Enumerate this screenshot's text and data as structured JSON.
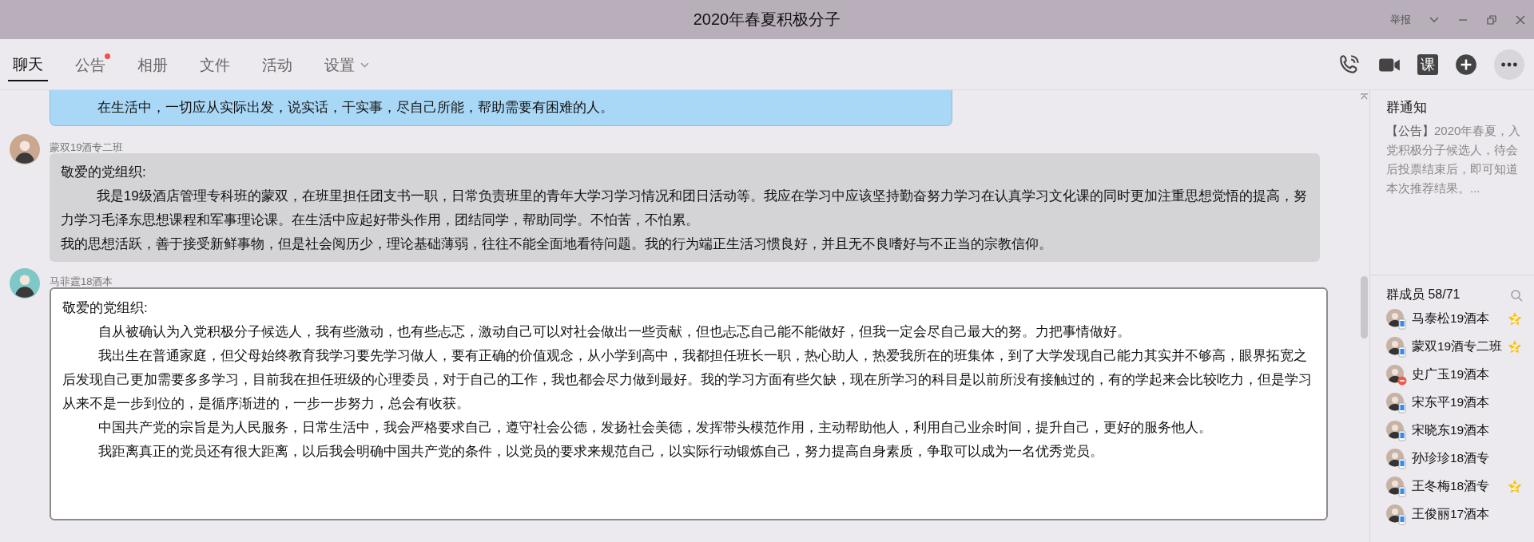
{
  "window": {
    "title": "2020年春夏积极分子",
    "report": "举报"
  },
  "tabs": [
    {
      "label": "聊天",
      "selected": true,
      "notification": false,
      "dropdown": false
    },
    {
      "label": "公告",
      "selected": false,
      "notification": true,
      "dropdown": false
    },
    {
      "label": "相册",
      "selected": false,
      "notification": false,
      "dropdown": false
    },
    {
      "label": "文件",
      "selected": false,
      "notification": false,
      "dropdown": false
    },
    {
      "label": "活动",
      "selected": false,
      "notification": false,
      "dropdown": false
    },
    {
      "label": "设置",
      "selected": false,
      "notification": false,
      "dropdown": true
    }
  ],
  "toolbar": [
    {
      "kind": "phone"
    },
    {
      "kind": "video"
    },
    {
      "kind": "lesson",
      "label": "课"
    },
    {
      "kind": "add"
    },
    {
      "kind": "more"
    }
  ],
  "messages": [
    {
      "kind": "announcement",
      "paragraphs": [
        {
          "text": "在生活中，一切应从实际出发，说实话，干实事，尽自己所能，帮助需要有困难的人。",
          "indented": true
        }
      ]
    },
    {
      "kind": "received",
      "sender": "蒙双19酒专二班",
      "paragraphs": [
        {
          "text": "敬爱的党组织:",
          "indented": false
        },
        {
          "text": "我是19级酒店管理专科班的蒙双，在班里担任团支书一职，日常负责班里的青年大学习学习情况和团日活动等。我应在学习中应该坚持勤奋努力学习在认真学习文化课的同时更加注重思想觉悟的提高，努力学习毛泽东思想课程和军事理论课。在生活中应起好带头作用，团结同学，帮助同学。不怕苦，不怕累。",
          "indented": true
        },
        {
          "text": "我的思想活跃，善于接受新鲜事物，但是社会阅历少，理论基础薄弱，往往不能全面地看待问题。我的行为端正生活习惯良好，并且无不良嗜好与不正当的宗教信仰。",
          "indented": false
        }
      ]
    },
    {
      "kind": "rich",
      "sender": "马菲霆18酒本",
      "paragraphs": [
        {
          "text": "敬爱的党组织:",
          "indented": false
        },
        {
          "text": "自从被确认为入党积极分子候选人，我有些激动，也有些忐忑，激动自己可以对社会做出一些贡献，但也忐忑自己能不能做好，但我一定会尽自己最大的努。力把事情做好。",
          "indented": true
        },
        {
          "text": "我出生在普通家庭，但父母始终教育我学习要先学习做人，要有正确的价值观念，从小学到高中，我都担任班长一职，热心助人，热爱我所在的班集体，到了大学发现自己能力其实并不够高，眼界拓宽之后发现自己更加需要多多学习，目前我在担任班级的心理委员，对于自己的工作，我也都会尽力做到最好。我的学习方面有些欠缺，现在所学习的科目是以前所没有接触过的，有的学起来会比较吃力，但是学习从来不是一步到位的，是循序渐进的，一步一步努力，总会有收获。",
          "indented": true
        },
        {
          "text": "中国共产党的宗旨是为人民服务，日常生活中，我会严格要求自己，遵守社会公德，发扬社会美德，发挥带头模范作用，主动帮助他人，利用自己业余时间，提升自己，更好的服务他人。",
          "indented": true
        },
        {
          "text": "我距离真正的党员还有很大距离，以后我会明确中国共产党的条件，以党员的要求来规范自己，以实际行动锻炼自己，努力提高自身素质，争取可以成为一名优秀党员。",
          "indented": true
        }
      ]
    }
  ],
  "notice": {
    "title": "群通知",
    "tag": "【公告】",
    "text": "2020年春夏，入党积极分子候选人，待会后投票结束后，即可知道本次推荐结果。..."
  },
  "members": {
    "title": "群成员 58/71",
    "list": [
      {
        "name": "马泰松19酒本",
        "kind": "mobile",
        "badge": true
      },
      {
        "name": "蒙双19酒专二班",
        "kind": "mobile",
        "badge": true
      },
      {
        "name": "史广玉19酒本",
        "kind": "busy",
        "badge": false
      },
      {
        "name": "宋东平19酒本",
        "kind": "mobile",
        "badge": false
      },
      {
        "name": "宋晓东19酒本",
        "kind": "mobile",
        "badge": false
      },
      {
        "name": "孙珍珍18酒专",
        "kind": "mobile",
        "badge": false
      },
      {
        "name": "王冬梅18酒专",
        "kind": "mobile",
        "badge": true
      },
      {
        "name": "王俊丽17酒本",
        "kind": "mobile",
        "badge": false
      }
    ]
  }
}
